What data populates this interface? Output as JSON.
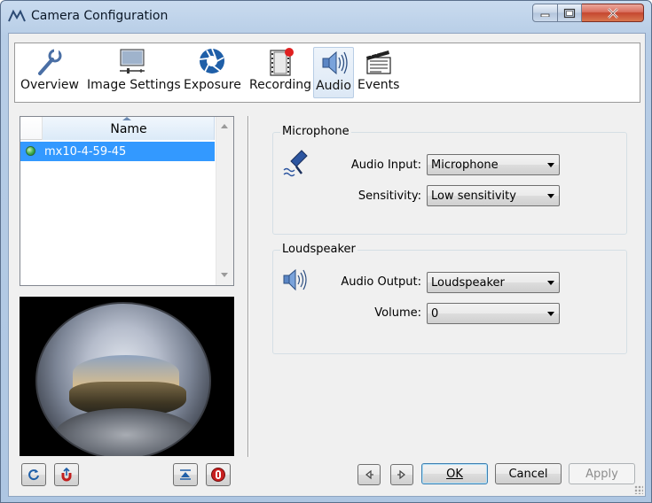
{
  "window": {
    "title": "Camera Configuration"
  },
  "toolbar": {
    "items": [
      {
        "label": "Overview",
        "icon": "wrench-icon"
      },
      {
        "label": "Image Settings",
        "icon": "image-settings-icon"
      },
      {
        "label": "Exposure",
        "icon": "aperture-icon"
      },
      {
        "label": "Recording",
        "icon": "film-record-icon"
      },
      {
        "label": "Audio",
        "icon": "speaker-icon",
        "active": true
      },
      {
        "label": "Events",
        "icon": "clapperboard-icon"
      }
    ]
  },
  "camera_list": {
    "column_header": "Name",
    "rows": [
      {
        "name": "mx10-4-59-45",
        "selected": true,
        "status": "online"
      }
    ]
  },
  "microphone": {
    "title": "Microphone",
    "audio_input_label": "Audio Input:",
    "audio_input_value": "Microphone",
    "sensitivity_label": "Sensitivity:",
    "sensitivity_value": "Low sensitivity"
  },
  "loudspeaker": {
    "title": "Loudspeaker",
    "audio_output_label": "Audio Output:",
    "audio_output_value": "Loudspeaker",
    "volume_label": "Volume:",
    "volume_value": "0"
  },
  "buttons": {
    "ok": "OK",
    "cancel": "Cancel",
    "apply": "Apply"
  },
  "colors": {
    "selection": "#3399ff",
    "status_online": "#3fae4d",
    "close_button": "#c54730"
  }
}
